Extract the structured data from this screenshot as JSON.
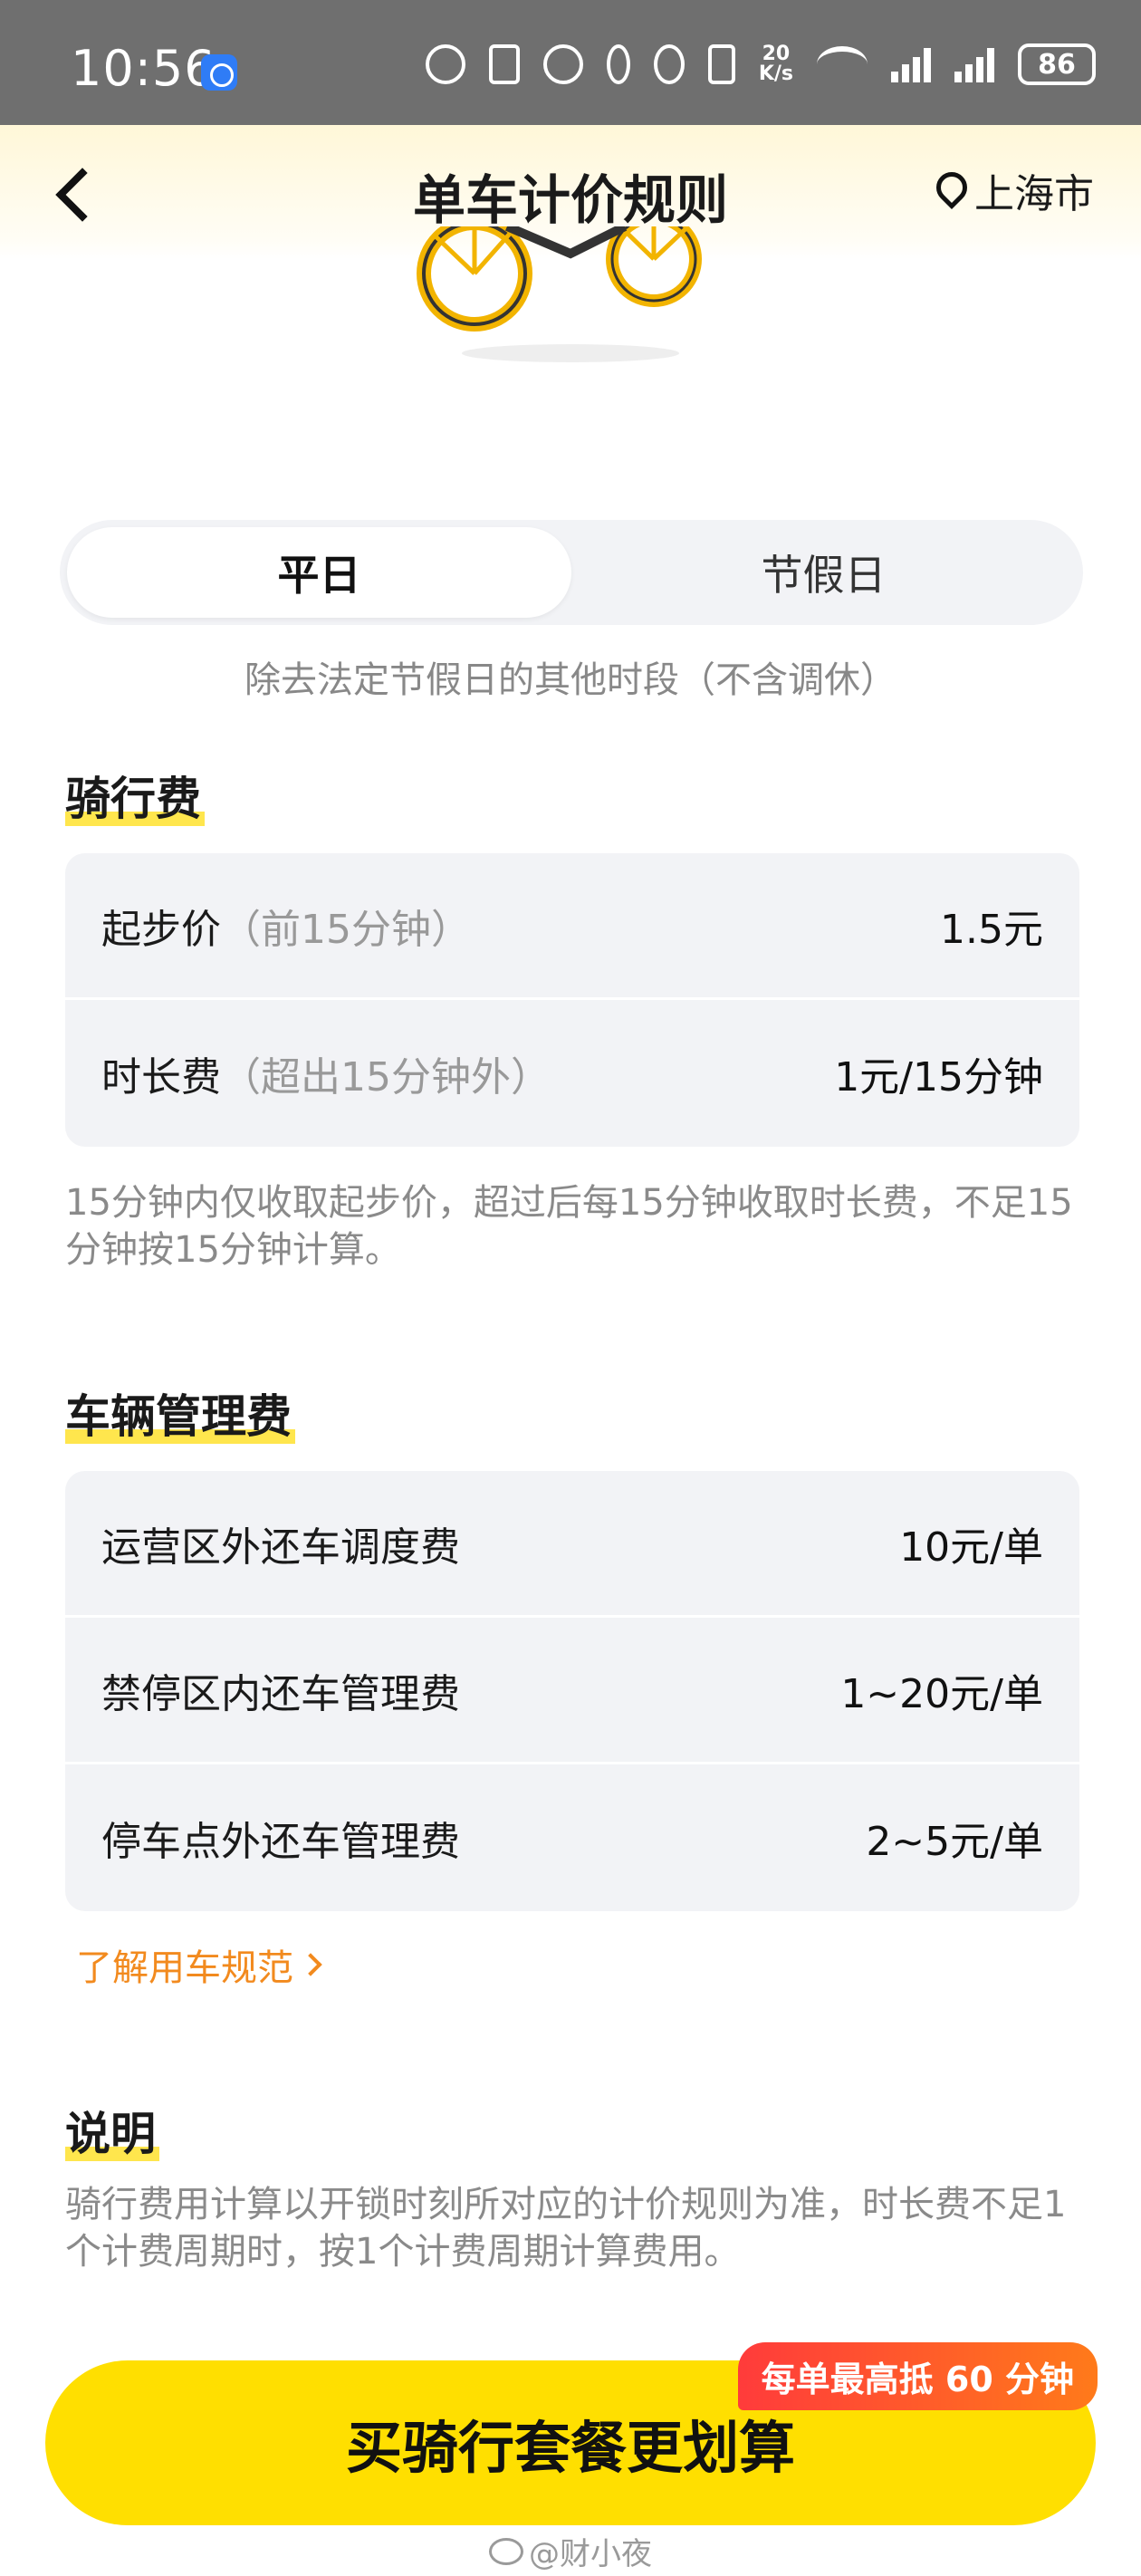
{
  "status_bar": {
    "time": "10:56",
    "net_speed_value": "20",
    "net_speed_unit": "K/s",
    "battery": "86"
  },
  "header": {
    "title": "单车计价规则",
    "location": "上海市"
  },
  "tabs": {
    "items": [
      {
        "label": "平日",
        "active": true
      },
      {
        "label": "节假日",
        "active": false
      }
    ],
    "description": "除去法定节假日的其他时段（不含调休）"
  },
  "riding_fee": {
    "title": "骑行费",
    "rows": [
      {
        "label": "起步价",
        "sub": "（前15分钟）",
        "value": "1.5元"
      },
      {
        "label": "时长费",
        "sub": "（超出15分钟外）",
        "value": "1元/15分钟"
      }
    ],
    "note": "15分钟内仅收取起步价，超过后每15分钟收取时长费，不足15分钟按15分钟计算。"
  },
  "management_fee": {
    "title": "车辆管理费",
    "rows": [
      {
        "label": "运营区外还车调度费",
        "value": "10元/单"
      },
      {
        "label": "禁停区内还车管理费",
        "value": "1~20元/单"
      },
      {
        "label": "停车点外还车管理费",
        "value": "2~5元/单"
      }
    ],
    "link": "了解用车规范"
  },
  "explanation": {
    "title": "说明",
    "text": "骑行费用计算以开锁时刻所对应的计价规则为准，时长费不足1个计费周期时，按1个计费周期计算费用。"
  },
  "cta": {
    "label": "买骑行套餐更划算",
    "badge": "每单最高抵 60 分钟"
  },
  "watermark": "@财小夜",
  "colors": {
    "accent_yellow": "#ffdf00",
    "link_orange": "#f28a1e",
    "badge_red": "#ff3b3b"
  }
}
